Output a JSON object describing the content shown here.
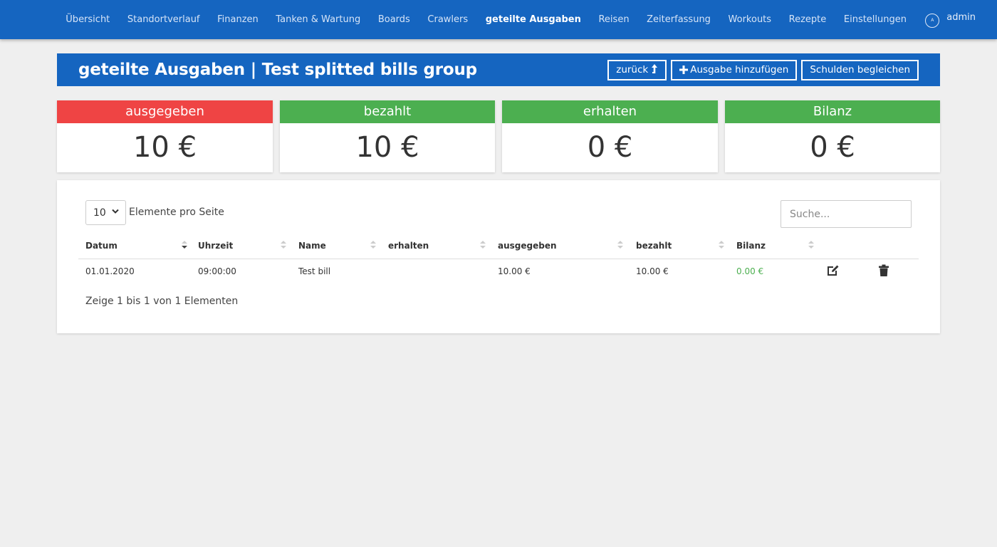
{
  "nav": {
    "items": [
      "Übersicht",
      "Standortverlauf",
      "Finanzen",
      "Tanken & Wartung",
      "Boards",
      "Crawlers",
      "geteilte Ausgaben",
      "Reisen",
      "Zeiterfassung",
      "Workouts",
      "Rezepte",
      "Einstellungen"
    ],
    "active": "geteilte Ausgaben",
    "user_initial": "A",
    "user_name": "admin"
  },
  "header": {
    "title": "geteilte Ausgaben | Test splitted bills group",
    "back_label": "zurück",
    "add_label": "Ausgabe hinzufügen",
    "settle_label": "Schulden begleichen"
  },
  "cards": [
    {
      "label": "ausgegeben",
      "value": "10 €",
      "color": "#ef4444"
    },
    {
      "label": "bezahlt",
      "value": "10 €",
      "color": "#4caf50"
    },
    {
      "label": "erhalten",
      "value": "0 €",
      "color": "#4caf50"
    },
    {
      "label": "Bilanz",
      "value": "0 €",
      "color": "#4caf50"
    }
  ],
  "table": {
    "page_size": "10",
    "page_size_label": "Elemente pro Seite",
    "search_placeholder": "Suche...",
    "columns": [
      "Datum",
      "Uhrzeit",
      "Name",
      "erhalten",
      "ausgegeben",
      "bezahlt",
      "Bilanz"
    ],
    "rows": [
      {
        "datum": "01.01.2020",
        "uhrzeit": "09:00:00",
        "name": "Test bill",
        "erhalten": "",
        "ausgegeben": "10.00 €",
        "bezahlt": "10.00 €",
        "bilanz": "0.00 €"
      }
    ],
    "info": "Zeige 1 bis 1 von 1 Elementen"
  },
  "icons": {
    "edit": "edit-icon",
    "delete": "trash-icon",
    "back": "arrow-up-icon",
    "add": "plus-icon",
    "user": "user-circle-icon"
  },
  "colors": {
    "primary": "#1565c0",
    "red": "#ef4444",
    "green": "#4caf50"
  }
}
